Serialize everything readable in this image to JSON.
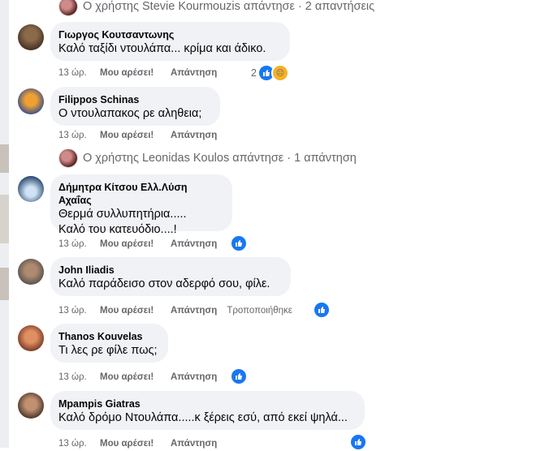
{
  "thread_reply_1": {
    "text": "Ο χρήστης Stevie Kourmouzis απάντησε · 2 απαντήσεις"
  },
  "thread_reply_2": {
    "text": "Ο χρήστης Leonidas Koulos απάντησε · 1 απάντηση"
  },
  "comments": [
    {
      "name": "Γιωργος Κουτσαντωνης",
      "lines": [
        "Καλό ταξίδι ντουλάπα... κρίμα και άδικο."
      ],
      "time": "13 ώρ.",
      "like": "Μου αρέσει!",
      "reply": "Απάντηση",
      "reaction_count": "2"
    },
    {
      "name": "Filippos Schinas",
      "lines": [
        "Ο ντουλαπακος ρε αληθεια;"
      ],
      "time": "13 ώρ.",
      "like": "Μου αρέσει!",
      "reply": "Απάντηση"
    },
    {
      "name": "Δήμητρα Κίτσου Ελλ.Λύση Αχαΐας",
      "lines": [
        "Θερμά συλλυπητήρια.....",
        "Καλό του κατευόδιο....!"
      ],
      "time": "13 ώρ.",
      "like": "Μου αρέσει!",
      "reply": "Απάντηση"
    },
    {
      "name": "John Iliadis",
      "lines": [
        "Καλό παράδεισο στον αδερφό σου, φίλε."
      ],
      "time": "13 ώρ.",
      "like": "Μου αρέσει!",
      "reply": "Απάντηση",
      "edited": "Τροποποιήθηκε"
    },
    {
      "name": "Thanos Kouvelas",
      "lines": [
        "Τι λες ρε φίλε πως;"
      ],
      "time": "13 ώρ.",
      "like": "Μου αρέσει!",
      "reply": "Απάντηση"
    },
    {
      "name": "Mpampis Giatras",
      "lines": [
        "Καλό δρόμο Ντουλάπα.....κ ξέρεις εσύ, από εκεί ψηλά..."
      ],
      "time": "13 ώρ.",
      "like": "Μου αρέσει!",
      "reply": "Απάντηση"
    }
  ],
  "icons": {
    "like": "like-icon",
    "sad": "sad-reaction-icon",
    "reply_arrow": "reply-arrow-icon"
  },
  "colors": {
    "bubble": "#f0f2f5",
    "meta": "#65676b",
    "like_blue": "#1877f2"
  }
}
